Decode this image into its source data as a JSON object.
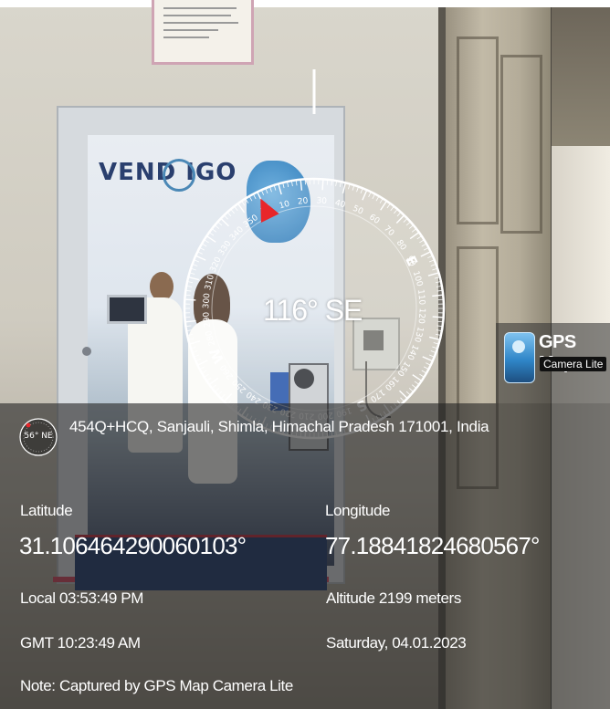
{
  "compass": {
    "heading": "116° SE",
    "heading_degrees": 116,
    "cardinals": [
      "E",
      "S",
      "W",
      "N"
    ],
    "ticks": [
      "50",
      "60",
      "70",
      "80",
      "90",
      "100",
      "110",
      "120",
      "130",
      "140",
      "150",
      "160",
      "170",
      "190",
      "200",
      "210",
      "220",
      "230",
      "240",
      "250",
      "260",
      "280",
      "290",
      "300",
      "310",
      "320",
      "330",
      "340",
      "350",
      "10",
      "20",
      "30",
      "40"
    ]
  },
  "mini_compass": {
    "label": "56° NE"
  },
  "location": {
    "address": "454Q+HCQ, Sanjauli, Shimla, Himachal Pradesh 171001, India",
    "latitude_label": "Latitude",
    "latitude_value": "31.106464290060103°",
    "longitude_label": "Longitude",
    "longitude_value": "77.18841824680567°",
    "local_time": "Local 03:53:49 PM",
    "altitude": "Altitude  2199 meters",
    "gmt_time": "GMT 10:23:49 AM",
    "date": "Saturday, 04.01.2023",
    "note": "Note: Captured by GPS Map Camera Lite"
  },
  "app_badge": {
    "title": "GPS Map",
    "subtitle": "Camera Lite"
  },
  "photo": {
    "brand": "VEND  IGO"
  },
  "colors": {
    "overlay": "#222222",
    "text": "#ffffff",
    "pointer": "#e8262a"
  }
}
